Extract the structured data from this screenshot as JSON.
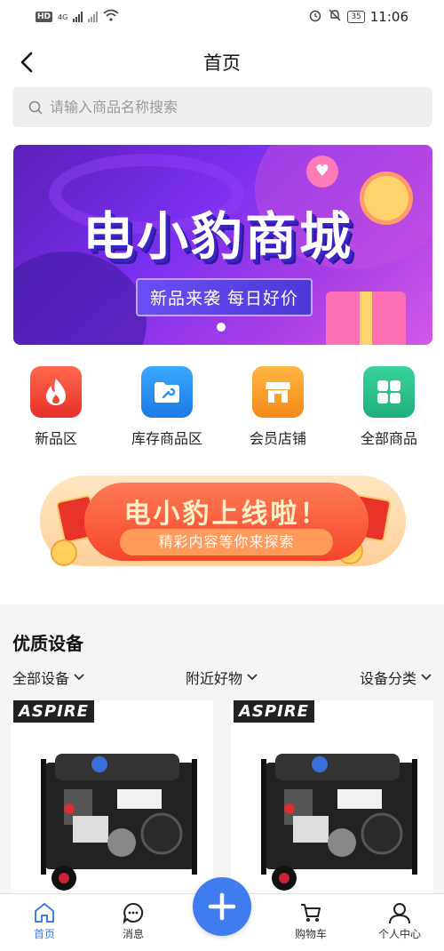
{
  "status_bar": {
    "hd": "HD",
    "network": "4G",
    "battery": "35",
    "time": "11:06"
  },
  "header": {
    "title": "首页"
  },
  "search": {
    "placeholder": "请输入商品名称搜索"
  },
  "banner": {
    "title": "电小豹商城",
    "subtitle": "新品来袭  每日好价"
  },
  "quick_nav": [
    {
      "label": "新品区",
      "icon": "flame-icon",
      "color": "#f2463a"
    },
    {
      "label": "库存商品区",
      "icon": "folder-wrench-icon",
      "color": "#2b8ff0"
    },
    {
      "label": "会员店铺",
      "icon": "shop-icon",
      "color": "#f7a22c"
    },
    {
      "label": "全部商品",
      "icon": "grid-icon",
      "color": "#2fc08a"
    }
  ],
  "promo": {
    "title": "电小豹上线啦！",
    "subtitle": "精彩内容等你来探索"
  },
  "section": {
    "title": "优质设备",
    "filters": [
      "全部设备",
      "附近好物",
      "设备分类"
    ]
  },
  "products": [
    {
      "brand": "ASPIRE"
    },
    {
      "brand": "ASPIRE"
    }
  ],
  "tab_bar": [
    {
      "label": "首页",
      "icon": "home-icon",
      "active": true
    },
    {
      "label": "消息",
      "icon": "message-icon",
      "active": false
    },
    {
      "label": "购物车",
      "icon": "cart-icon",
      "active": false
    },
    {
      "label": "个人中心",
      "icon": "user-icon",
      "active": false
    }
  ],
  "colors": {
    "accent": "#3f7cf0",
    "search_bg": "#efefef",
    "section_bg": "#f5f5f5"
  }
}
